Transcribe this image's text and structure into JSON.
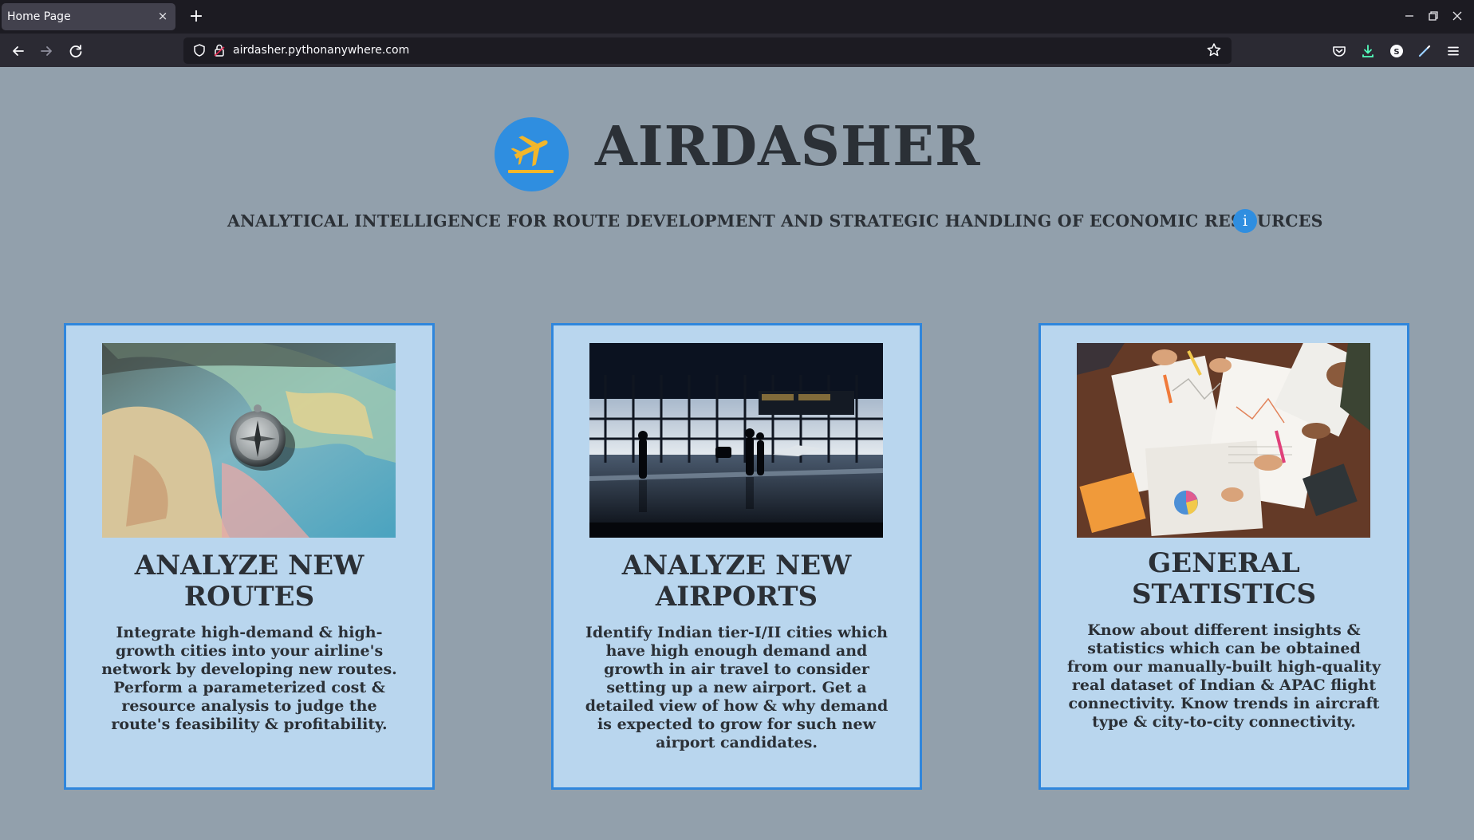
{
  "browser": {
    "tab_title": "Home Page",
    "tab_close": "×",
    "new_tab": "+",
    "url": "airdasher.pythonanywhere.com",
    "icons": [
      "back-icon",
      "forward-icon",
      "reload-icon",
      "shield-icon",
      "lock-icon",
      "star-icon",
      "pocket-icon",
      "download-icon",
      "account-icon",
      "extension-icon",
      "menu-icon"
    ],
    "window_controls": [
      "minimize",
      "restore",
      "close"
    ]
  },
  "header": {
    "brand": "AIRDASHER",
    "tagline": "ANALYTICAL INTELLIGENCE FOR ROUTE DEVELOPMENT AND STRATEGIC HANDLING OF ECONOMIC RESOURCES",
    "info_label": "i",
    "logo_icon": "airplane-departure-icon",
    "accent_color": "#2f8ee0",
    "logo_plane_color": "#f2b62a"
  },
  "cards": [
    {
      "title": "ANALYZE NEW ROUTES",
      "description": "Integrate high-demand & high-growth cities into your airline's network by developing new routes. Perform a parameterized cost & resource analysis to judge the route's feasibility & profitability.",
      "image": "map-with-compass"
    },
    {
      "title": "ANALYZE NEW AIRPORTS",
      "description": "Identify Indian tier-I/II cities which have high enough demand and growth in air travel to consider setting up a new airport. Get a detailed view of how & why demand is expected to grow for such new airport candidates.",
      "image": "airport-terminal-silhouettes"
    },
    {
      "title": "GENERAL STATISTICS",
      "description": "Know about different insights & statistics which can be obtained from our manually-built high-quality real dataset of Indian & APAC flight connectivity. Know trends in aircraft type & city-to-city connectivity.",
      "image": "team-analyzing-charts"
    }
  ],
  "colors": {
    "page_background": "#92a0ac",
    "card_background": "#b9d6ee",
    "card_border": "#2f86dc",
    "text": "#2b3036"
  }
}
